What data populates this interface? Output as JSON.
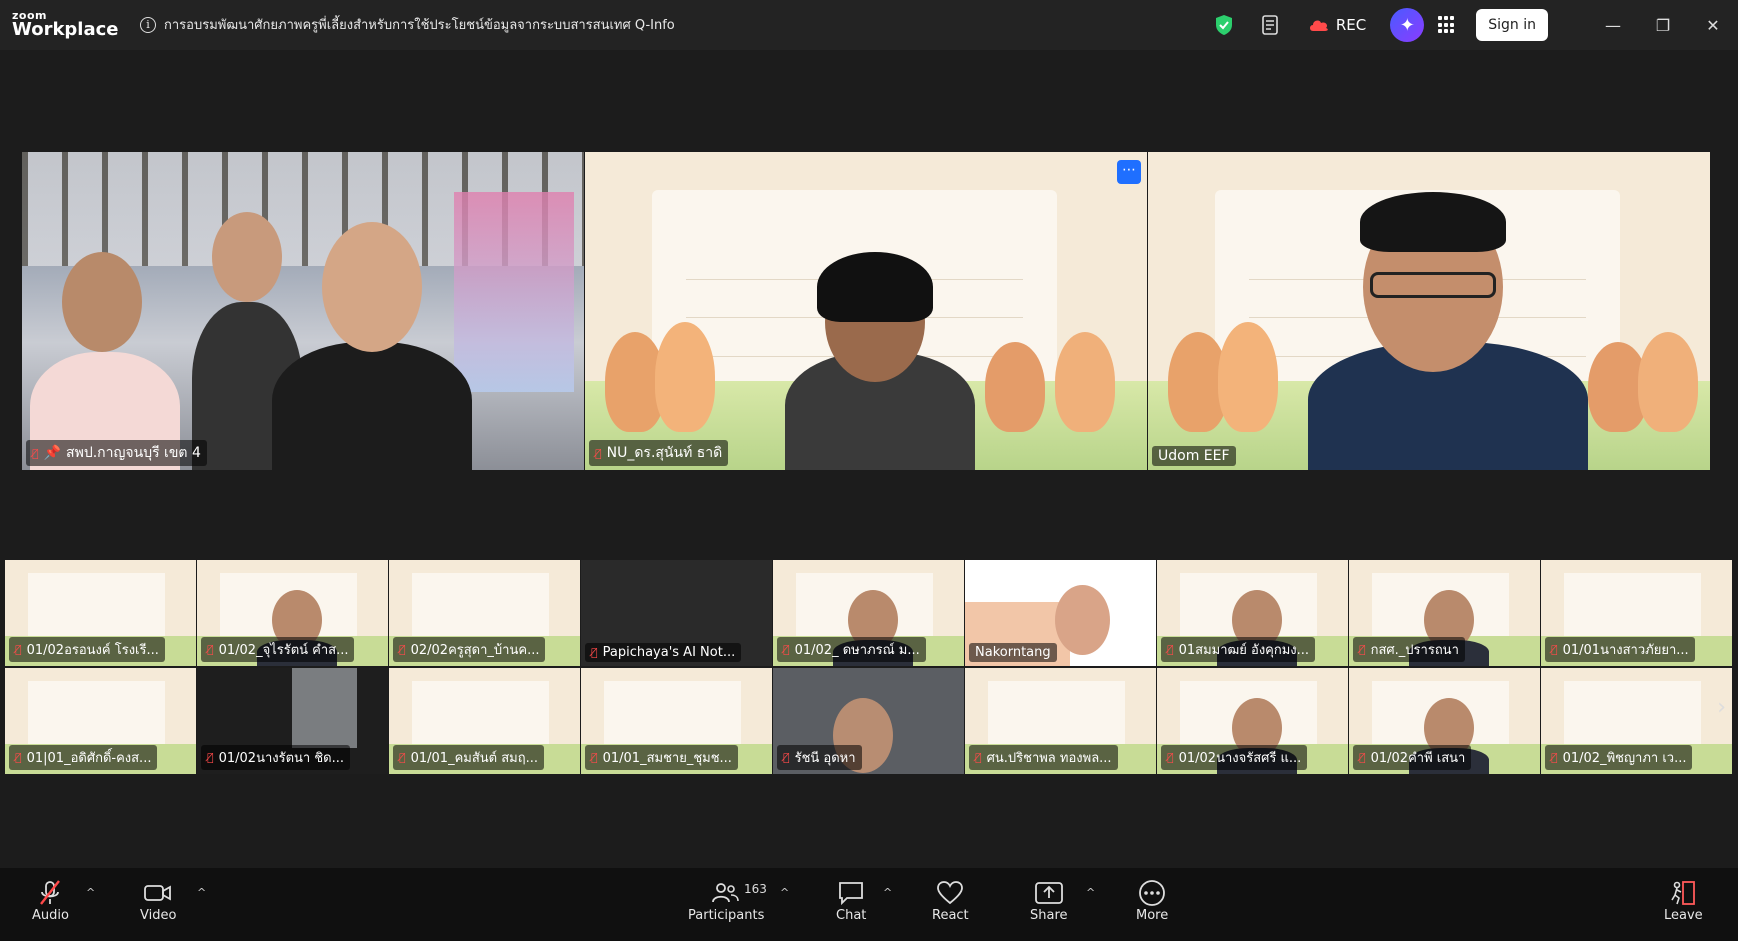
{
  "app": {
    "brand_small": "zoom",
    "brand_large": "Workplace"
  },
  "meeting": {
    "title": "การอบรมพัฒนาศักยภาพครูพี่เลี้ยงสำหรับการใช้ประโยชน์ข้อมูลจากระบบสารสนเทศ Q-Info"
  },
  "titlebar": {
    "rec_label": "REC",
    "signin_label": "Sign in"
  },
  "speakers": [
    {
      "name": "สพป.กาญจนบุรี เขต 4"
    },
    {
      "name": "NU_ดร.สุนันท์ ธาดิ"
    },
    {
      "name": "Udom EEF"
    }
  ],
  "gallery_row1": [
    "01/02อรอนงค์ โรงเรี...",
    "01/02_จุไรรัตน์ คำส...",
    "02/02ครูสุดา_บ้านค...",
    "Papichaya's AI Not...",
    "01/02_ ดษาภรณ์ ม...",
    "Nakorntang",
    "01สมมาฒย์ อังคุกมง...",
    "กสศ._ปรารถนา",
    "01/01นางสาวภัยยา..."
  ],
  "gallery_row2": [
    "01|01_อดิศักดิ์-คงส...",
    "01/02นางรัตนา ชิด...",
    "01/01_คมสันต์ สมฤ...",
    "01/01_สมชาย_ชุมช...",
    "รัชนี อุดหา",
    "ศน.ปริชาพล ทองพล...",
    "01/02นางจรัสศรี แ...",
    "01/02คำพี เสนา",
    "01/02_พิชญาภา เว..."
  ],
  "toolbar": {
    "audio": "Audio",
    "video": "Video",
    "participants": "Participants",
    "participants_count": "163",
    "chat": "Chat",
    "react": "React",
    "share": "Share",
    "more": "More",
    "leave": "Leave"
  },
  "colors": {
    "active_speaker": "#2ccf6d",
    "mute": "#ff4a4a",
    "toolbar_bg": "#101010"
  }
}
